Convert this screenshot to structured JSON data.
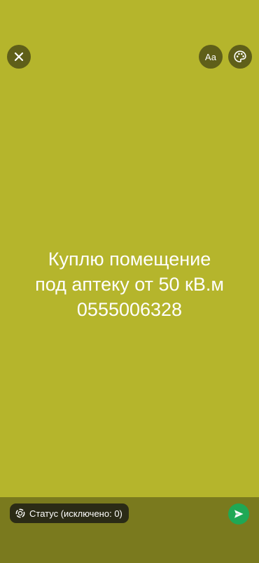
{
  "status": {
    "lines": [
      "Куплю помещение",
      "под аптеку от 50 кВ.м",
      "0555006328"
    ],
    "background_color": "#b5b52c",
    "text_color": "#ffffff"
  },
  "toolbar": {
    "close_icon": "close-icon",
    "font_label": "Aa",
    "palette_icon": "palette-icon"
  },
  "footer": {
    "privacy_label": "Статус (исключено: 0)",
    "privacy_icon": "status-privacy-icon",
    "send_icon": "send-icon",
    "send_color": "#1fa855"
  }
}
